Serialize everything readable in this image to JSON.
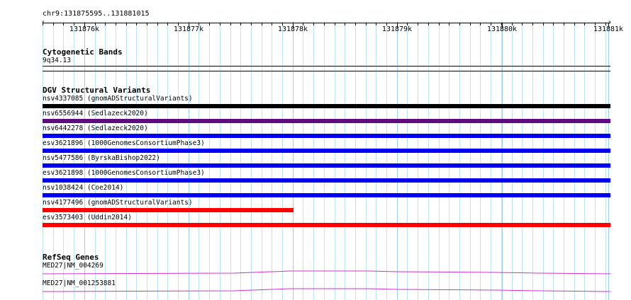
{
  "location": "chr9:131875595..131881015",
  "ruler": {
    "ticks": [
      "131876k",
      "131877k",
      "131878k",
      "131879k",
      "131880k",
      "131881k"
    ]
  },
  "tracks": {
    "cytobands": {
      "title": "Cytogenetic Bands",
      "band_label": "9q34.13"
    },
    "dgv": {
      "title": "DGV Structural Variants",
      "variants": [
        {
          "label": "nsv4337085 (gnomADStructuralVariants)",
          "color": "#000000",
          "partial": false
        },
        {
          "label": "nsv6556944 (Sedlazeck2020)",
          "color": "#5b0e82",
          "partial": false
        },
        {
          "label": "nsv6442278 (Sedlazeck2020)",
          "color": "#0000ee",
          "partial": false
        },
        {
          "label": "esv3621896 (1000GenomesConsortiumPhase3)",
          "color": "#0000ee",
          "partial": false
        },
        {
          "label": "nsv5477586 (ByrskaBishop2022)",
          "color": "#0000ee",
          "partial": false
        },
        {
          "label": "esv3621898 (1000GenomesConsortiumPhase3)",
          "color": "#0000ee",
          "partial": false
        },
        {
          "label": "nsv1038424 (Coe2014)",
          "color": "#0000ee",
          "partial": false
        },
        {
          "label": "nsv4177496 (gnomADStructuralVariants)",
          "color": "#ff0000",
          "partial": true
        },
        {
          "label": "esv3573403 (Uddin2014)",
          "color": "#ff0000",
          "partial": false
        }
      ]
    },
    "refseq": {
      "title": "RefSeq Genes",
      "genes": [
        {
          "label": "MED27|NM_004269",
          "color": "#cc33cc"
        },
        {
          "label": "MED27|NM_001253881",
          "color": "#cc33cc"
        }
      ]
    }
  }
}
